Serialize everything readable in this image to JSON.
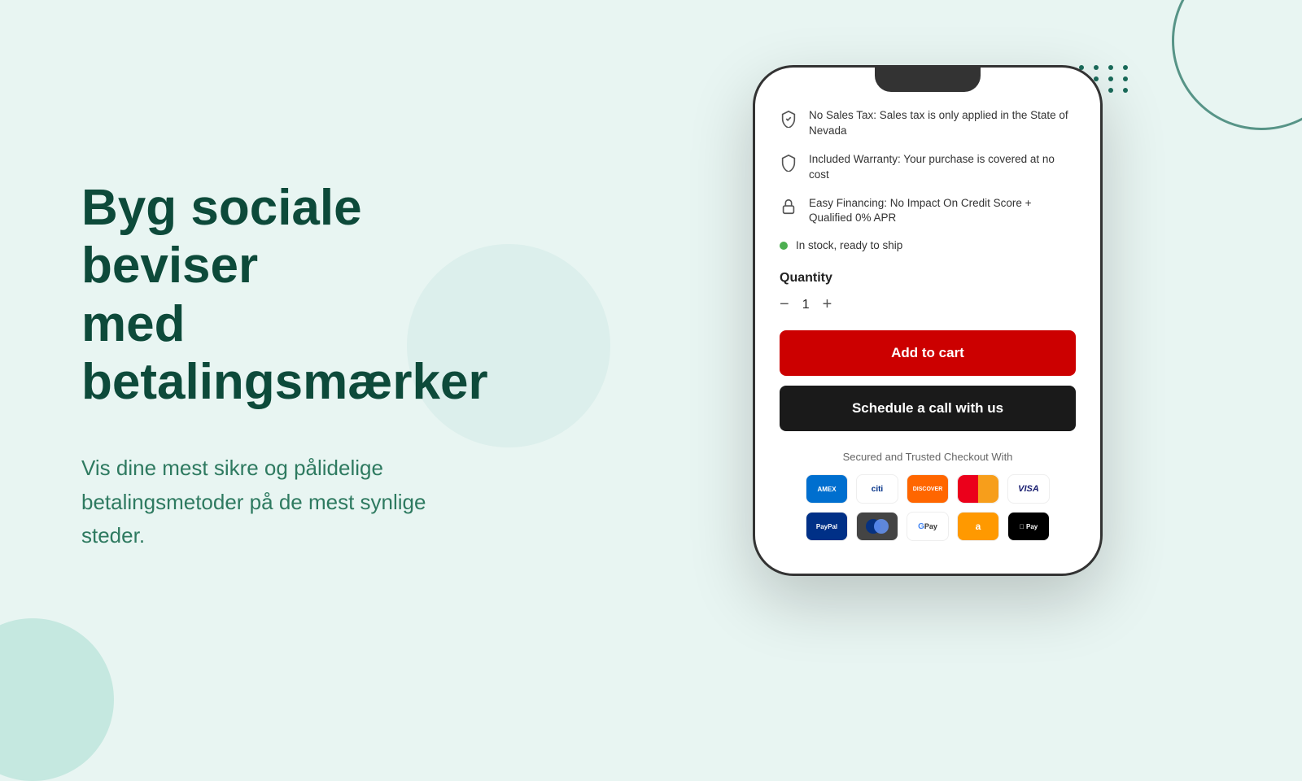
{
  "page": {
    "background_color": "#e8f5f2"
  },
  "left": {
    "headline_line1": "Byg sociale beviser",
    "headline_line2": "med betalingsmærker",
    "subtext": "Vis dine mest sikre og pålidelige betalingsmetoder på de mest synlige steder."
  },
  "phone": {
    "features": [
      {
        "icon": "check-shield",
        "text": "No Sales Tax: Sales tax is only applied in the State of Nevada"
      },
      {
        "icon": "shield",
        "text": "Included Warranty: Your purchase is covered at no cost"
      },
      {
        "icon": "lock",
        "text": "Easy Financing: No Impact On Credit Score + Qualified 0% APR"
      }
    ],
    "in_stock_text": "In stock, ready to ship",
    "quantity_label": "Quantity",
    "quantity_value": "1",
    "quantity_minus": "−",
    "quantity_plus": "+",
    "add_to_cart_label": "Add to cart",
    "schedule_call_label": "Schedule a call with us",
    "payment_label": "Secured and Trusted Checkout With",
    "payment_methods_row1": [
      "AMEX",
      "citi",
      "DISCOVER",
      "MC",
      "VISA"
    ],
    "payment_methods_row2": [
      "PayPal",
      "Diners",
      "G Pay",
      "a",
      "Apple Pay"
    ]
  }
}
